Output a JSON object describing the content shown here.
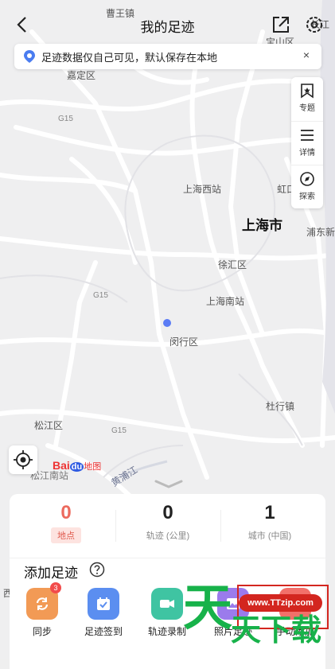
{
  "header": {
    "title": "我的足迹"
  },
  "notice": {
    "text": "足迹数据仅自己可见，默认保存在本地",
    "close": "×"
  },
  "toolbar": {
    "items": [
      {
        "label": "专题",
        "icon": "bookmark-icon"
      },
      {
        "label": "详情",
        "icon": "list-icon"
      },
      {
        "label": "探索",
        "icon": "compass-icon"
      }
    ]
  },
  "map": {
    "labels": {
      "caowang": "曹王镇",
      "jiading": "嘉定区",
      "baoshan": "宝山区",
      "changjiang": "长江",
      "g15a": "G15",
      "g15b": "G15",
      "g15c": "G15",
      "shanghaiwest": "上海西站",
      "hongkou": "虹口",
      "shanghai": "上海市",
      "pudong": "浦东新",
      "xuhui": "徐汇区",
      "shanghaisouth": "上海南站",
      "minhang": "闵行区",
      "songjiang": "松江区",
      "songjiangsouth": "松江南站",
      "huangpu": "黄浦江",
      "duhang": "杜行镇",
      "xi": "西"
    },
    "logo": {
      "bai": "Bai",
      "du": "du",
      "ditu": "地图"
    }
  },
  "stats": [
    {
      "value": "0",
      "label": "地点"
    },
    {
      "value": "0",
      "label": "轨迹 (公里)"
    },
    {
      "value": "1",
      "label": "城市 (中国)"
    }
  ],
  "section": {
    "title": "添加足迹"
  },
  "actions": [
    {
      "label": "同步",
      "badge": "3",
      "color": "#f29a55"
    },
    {
      "label": "足迹签到",
      "color": "#5b8ef0"
    },
    {
      "label": "轨迹录制",
      "color": "#3fc4a2"
    },
    {
      "label": "照片足迹",
      "color": "#9b7bec"
    },
    {
      "label": "手动添加",
      "color": "#f2706a"
    }
  ],
  "watermark": {
    "site": "www.TTzip.com",
    "big": "天",
    "sub": "天下载"
  }
}
